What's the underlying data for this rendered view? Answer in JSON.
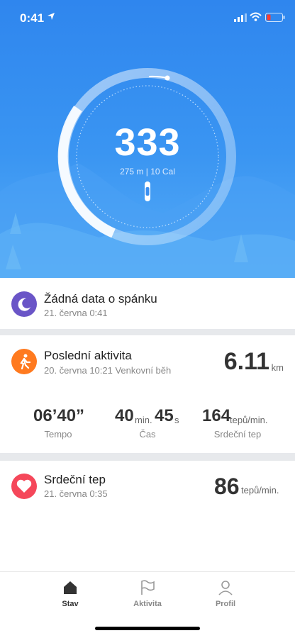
{
  "status": {
    "time": "0:41"
  },
  "hero": {
    "steps": "333",
    "subline": "275 m | 10 Cal"
  },
  "sleep": {
    "title": "Žádná data o spánku",
    "meta": "21. června 0:41"
  },
  "activity": {
    "title": "Poslední aktivita",
    "meta": "20. června 10:21 Venkovní běh",
    "distance": "6.11",
    "distance_unit": "km",
    "pace": "06’40”",
    "pace_label": "Tempo",
    "time_min": "40",
    "time_min_unit": "min.",
    "time_sec": "45",
    "time_sec_unit": "s",
    "time_label": "Čas",
    "hr": "164",
    "hr_unit": "tepů/min.",
    "hr_label": "Srdeční tep"
  },
  "heart": {
    "title": "Srdeční tep",
    "meta": "21. června 0:35",
    "value": "86",
    "unit": "tepů/min."
  },
  "tabs": [
    {
      "label": "Stav"
    },
    {
      "label": "Aktivita"
    },
    {
      "label": "Profil"
    }
  ],
  "colors": {
    "hero_blue": "#2f86ee",
    "sleep_purple": "#6a55c7",
    "activity_orange": "#ff7a1f",
    "heart_red": "#f5475a"
  }
}
